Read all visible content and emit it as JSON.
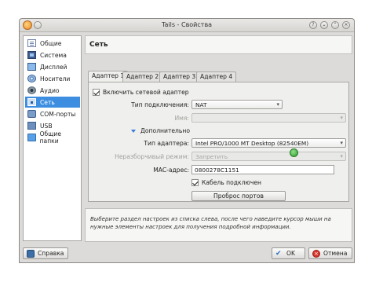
{
  "window": {
    "title": "Tails - Свойства"
  },
  "sidebar": {
    "items": [
      {
        "label": "Общие",
        "icon": "general-icon"
      },
      {
        "label": "Система",
        "icon": "system-icon"
      },
      {
        "label": "Дисплей",
        "icon": "display-icon"
      },
      {
        "label": "Носители",
        "icon": "storage-icon"
      },
      {
        "label": "Аудио",
        "icon": "audio-icon"
      },
      {
        "label": "Сеть",
        "icon": "network-icon",
        "selected": true
      },
      {
        "label": "COM-порты",
        "icon": "serial-ports-icon"
      },
      {
        "label": "USB",
        "icon": "usb-icon"
      },
      {
        "label": "Общие папки",
        "icon": "shared-folders-icon"
      }
    ]
  },
  "header": {
    "title": "Сеть"
  },
  "tabs": [
    "Адаптер 1",
    "Адаптер 2",
    "Адаптер 3",
    "Адаптер 4"
  ],
  "adapter": {
    "enable_label": "Включить сетевой адаптер",
    "enable_checked": true,
    "attach_label": "Тип подключения:",
    "attach_value": "NAT",
    "name_label": "Имя:",
    "name_value": "",
    "advanced_label": "Дополнительно",
    "type_label": "Тип адаптера:",
    "type_value": "Intel PRO/1000 MT Desktop (82540EM)",
    "promisc_label": "Неразборчивый режим:",
    "promisc_value": "Запретить",
    "mac_label": "MAC-адрес:",
    "mac_value": "0800278C1151",
    "cable_label": "Кабель подключен",
    "cable_checked": true,
    "port_forward_label": "Проброс портов"
  },
  "info": {
    "text": "Выберите раздел настроек из списка слева, после чего наведите курсор мыши на нужные элементы настроек для получения подробной информации."
  },
  "buttons": {
    "help": "Справка",
    "ok": "OK",
    "cancel": "Отмена"
  },
  "colors": {
    "selection": "#3d8ee0",
    "accent": "#3a7bd5"
  }
}
